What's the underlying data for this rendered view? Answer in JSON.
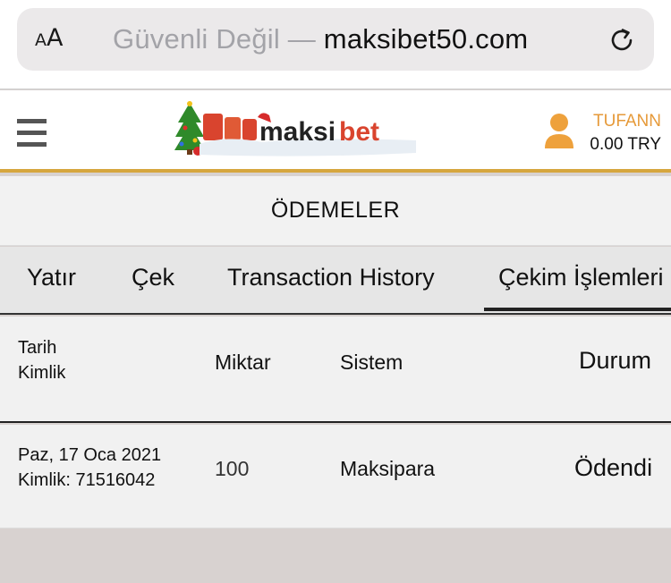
{
  "browser": {
    "text_size_label_small": "A",
    "text_size_label_big": "A",
    "security_prefix": "Güvenli Değil — ",
    "domain": "maksibet50.com"
  },
  "header": {
    "logo_text": "maksibet",
    "username": "TUFANN",
    "balance": "0.00 TRY",
    "accent_color": "#d6a63e",
    "username_color": "#e69a3a"
  },
  "page": {
    "title": "ÖDEMELER"
  },
  "tabs": [
    {
      "label": "Yatır",
      "active": false
    },
    {
      "label": "Çek",
      "active": false
    },
    {
      "label": "Transaction History",
      "active": false
    },
    {
      "label": "Çekim İşlemleri",
      "active": true
    }
  ],
  "table": {
    "headers": {
      "date": "Tarih",
      "id": "Kimlik",
      "amount": "Miktar",
      "system": "Sistem",
      "status": "Durum"
    },
    "rows": [
      {
        "date": "Paz, 17 Oca 2021",
        "id": "Kimlik: 71516042",
        "amount": "100",
        "system": "Maksipara",
        "status": "Ödendi"
      }
    ]
  }
}
